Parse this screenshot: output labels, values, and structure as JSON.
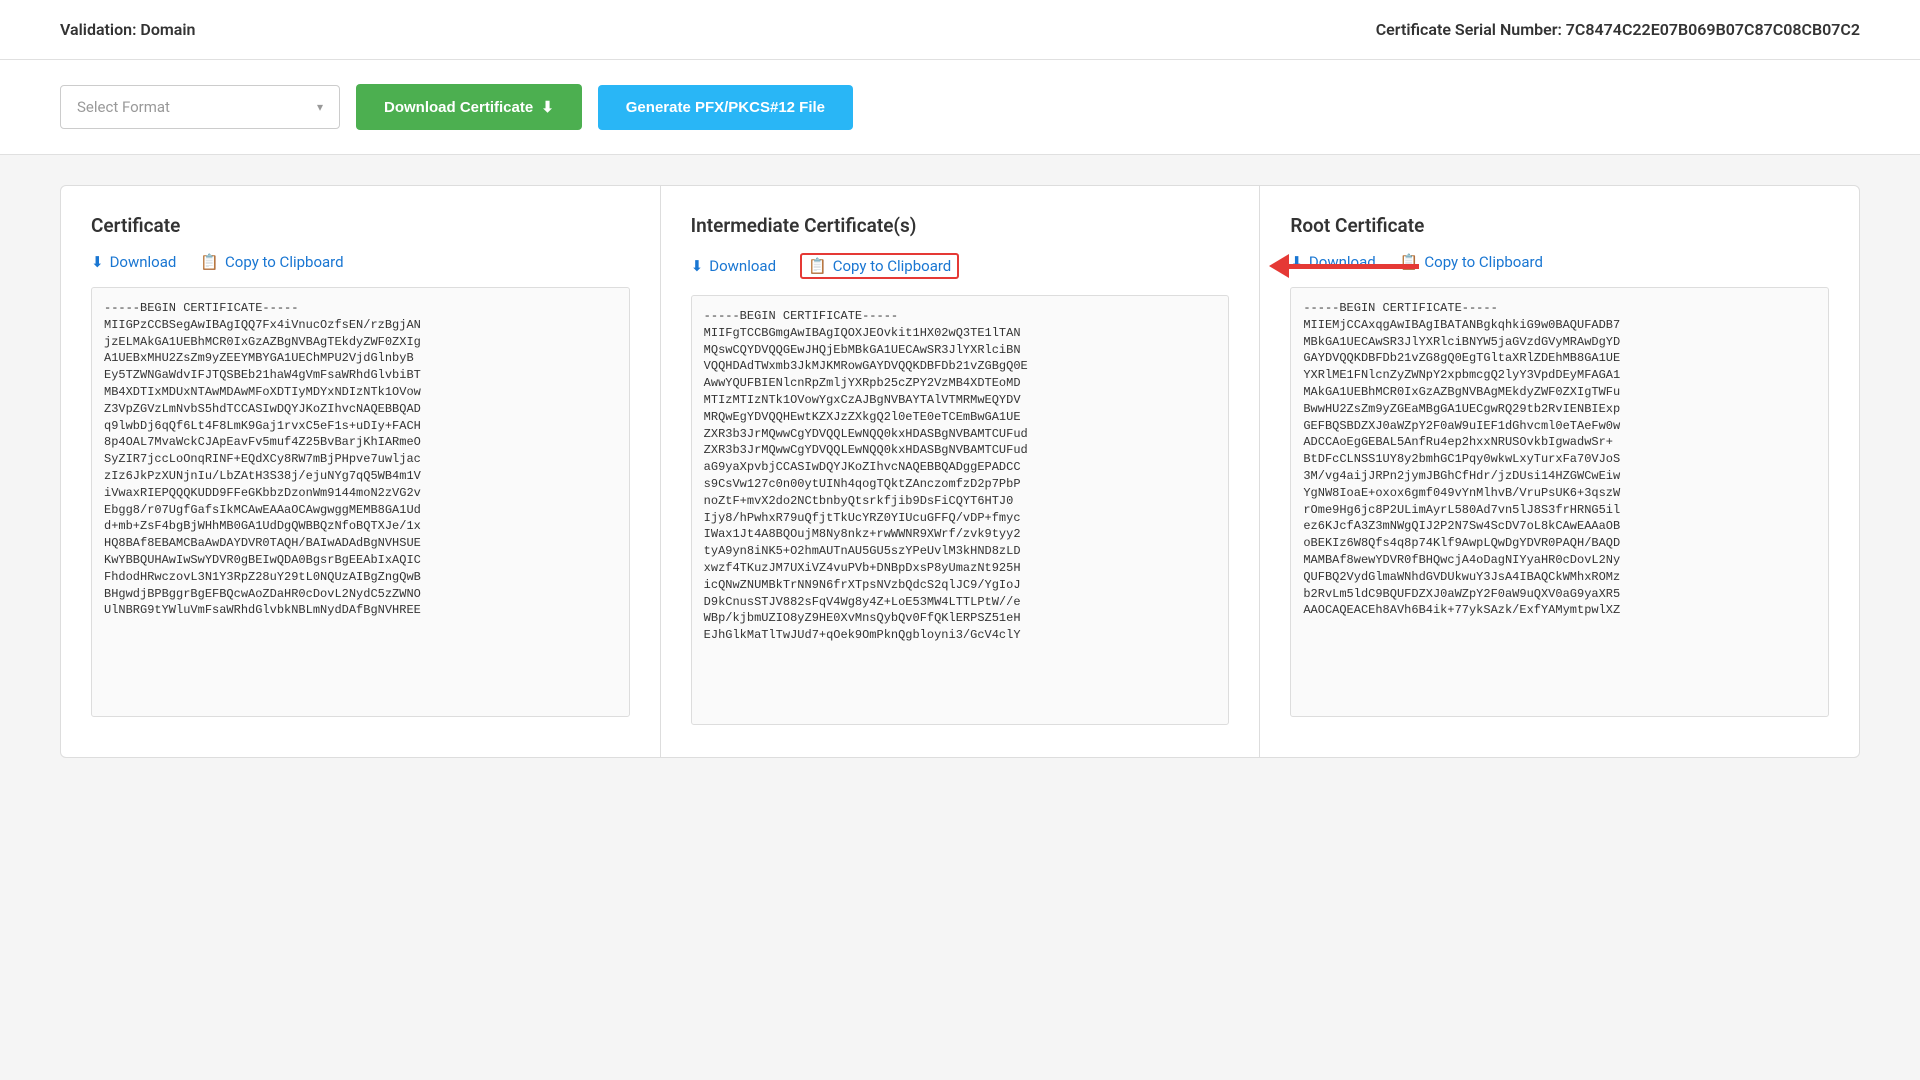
{
  "topbar": {
    "validation_label": "Validation:",
    "validation_value": "Domain",
    "serial_label": "Certificate Serial Number:",
    "serial_value": "7C8474C22E07B069B07C87C08CB07C2"
  },
  "toolbar": {
    "select_format_placeholder": "Select Format",
    "download_cert_label": "Download Certificate",
    "download_cert_icon": "⬇",
    "generate_pfx_label": "Generate PFX/PKCS#12 File"
  },
  "cards": [
    {
      "title": "Certificate",
      "download_label": "Download",
      "copy_label": "Copy to Clipboard",
      "content": "-----BEGIN CERTIFICATE-----\nMIIGPzCCBSegAwIBAgIQQ7Fx4iVnucOzfsEN/rzBgjAN\njzELMAkGA1UEBhMCR0IxGzAZBgNVBAgTEkdyZWF0ZXIg\nA1UEBxMHU2ZsZm9yZEEYMBYGA1UEChMPU2VjdGlnbyB\nEy5TZWNGaWdvIFJTQSBEb21haW4gVmFsaWRhdGlvbiBT\nMB4XDTIxMDUxNTAwMDAwMFoXDTIyMDYxNDIzNTk1OVow\nZ3VpZGVzLmNvbS5hdTCCASIwDQYJKoZIhvcNAQEBBQAD\nq9lwbDj6qQf6Lt4F8LmK9Gaj1rvxC5eF1s+uDIy+FACH\n8p4OAL7MvaWckCJApEavFv5muf4Z25BvBarjKhIARmeO\nSyZIR7jccLoOnqRINF+EQdXCy8RW7mBjPHpve7uwljac\nzIz6JkPzXUNjnIu/LbZAtH3S38j/ejuNYg7qQ5WB4m1V\niVwaxRIEPQQQKUDD9FFeGKbbzDzonWm9144moN2zVG2v\nEbgg8/r07UgfGafsIkMCAwEAAaOCAwgwggMEMB8GA1Ud\nd+mb+ZsF4bgBjWHhMB0GA1UdDgQWBBQzNfoBQTXJe/1x\nHQ8BAf8EBAMCBaAwDAYDVR0TAQH/BAIwADAdBgNVHSUE\nKwYBBQUHAwIwSwYDVR0gBEIwQDA0BgsrBgEEAbIxAQIC\nFhdodHRwczovL3N1Y3RpZ28uY29tL0NQUzAIBgZngQwB\nBHgwdjBPBggrBgEFBQcwAoZDaHR0cDovL2NydC5zZWNO\nUlNBRG9tYWluVmFsaWRhdGlvbkNBLmNydDAfBgNVHREE"
    },
    {
      "title": "Intermediate Certificate(s)",
      "download_label": "Download",
      "copy_label": "Copy to Clipboard",
      "highlighted": true,
      "content": "-----BEGIN CERTIFICATE-----\nMIIFgTCCBGmgAwIBAgIQOXJEOvkit1HX02wQ3TE1lTAN\nMQswCQYDVQQGEwJHQjEbMBkGA1UECAwSR3JlYXRlciBN\nVQQHDAdTWxmb3JkMJKMRowGAYDVQQKDBFDb21vZGBgQ0E\nAwwYQUFBIENlcnRpZmljYXRpb25cZPY2VzMB4XDTEoMD\nMTIzMTIzNTk1OVowYgxCzAJBgNVBAYTAlVTMRMwEQYDV\nMRQwEgYDVQQHEwtKZXJzZXkgQ2l0eTE0eTCEmBwGA1UE\nZXR3b3JrMQwwCgYDVQQLEwNQQ0kxHDASBgNVBAMTCUFud\nZXR3b3JrMQwwCgYDVQQLEwNQQ0kxHDASBgNVBAMTCUFud\naG9yaXpvbjCCASIwDQYJKoZIhvcNAQEBBQADggEPADCC\ns9CsVw127c0n00ytUINh4qogTQktZAnczomfzD2p7PbP\nnoZtF+mvX2do2NCtbnbyQtsrkfjib9DsFiCQYT6HTJ0\nIjy8/hPwhxR79uQfjtTkUcYRZ0YIUcuGFFQ/vDP+fmyc\nIWax1Jt4A8BQOujM8Ny8nkz+rwWWNR9XWrf/zvk9tyy2\ntyA9yn8iNK5+O2hmAUTnAU5GU5szYPeUvlM3kHND8zLD\nxwzf4TKuzJM7UXiVZ4vuPVb+DNBpDxsP8yUmazNt925H\nicQNwZNUMBkTrNN9N6frXTpsNVzbQdcS2qlJC9/YgIoJ\nD9kCnusSTJV882sFqV4Wg8y4Z+LoE53MW4LTTLPtW//e\nWBp/kjbmUZIO8yZ9HE0XvMnsQybQv0FfQKlERPSZ51eH\nEJhGlkMaTlTwJUd7+qOek9OmPknQgbloyni3/GcV4clY"
    },
    {
      "title": "Root Certificate",
      "download_label": "Download",
      "copy_label": "Copy to Clipboard",
      "content": "-----BEGIN CERTIFICATE-----\nMIIEMjCCAxqgAwIBAgIBATANBgkqhkiG9w0BAQUFADB7\nMBkGA1UECAwSR3JlYXRlciBNYW5jaGVzdGVyMRAwDgYD\nGAYDVQQKDBFDb21vZG8gQ0EgTGltaXRlZDEhMB8GA1UE\nYXRlME1FNlcnZyZWNpY2xpbmcgQ2lyY3VpdDEyMFAGA1\nMAkGA1UEBhMCR0IxGzAZBgNVBAgMEkdyZWF0ZXIgTWFu\nBwwHU2ZsZm9yZGEaMBgGA1UECgwRQ29tb2RvIENBIExp\nGEFBQSBDZXJ0aWZpY2F0aW9uIEF1dGhvcml0eTAeFw0w\nADCCAoEgGEBAL5AnfRu4ep2hxxNRUSOvkbIgwadwSr+\nBtDFcCLNSS1UY8y2bmhGC1Pqy0wkwLxyTurxFa70VJoS\n3M/vg4aijJRPn2jymJBGhCfHdr/jzDUsi14HZGWCwEiw\nYgNW8IoaE+oxox6gmf049vYnMlhvB/VruPsUK6+3qszW\nrOme9Hg6jc8P2ULimAyrL580Ad7vn5lJ8S3frHRNG5il\nez6KJcfA3Z3mNWgQIJ2P2N7Sw4ScDV7oL8kCAwEAAaOB\noBEKIz6W8Qfs4q8p74Klf9AwpLQwDgYDVR0PAQH/BAQD\nMAMBAf8wewYDVR0fBHQwcjA4oDagNIYyaHR0cDovL2Ny\nQUFBQ2VydGlmaWNhdGVDUkwuY3JsA4IBAQCkWMhxROMz\nb2RvLm5ldC9BQUFDZXJ0aWZpY2F0aW9uQXV0aG9yaXR5\nAAOCAQEACEh8AVh6B4ik+77ykSAzk/ExfYAMymtpwlXZ"
    }
  ],
  "arrow": {
    "visible": true
  }
}
